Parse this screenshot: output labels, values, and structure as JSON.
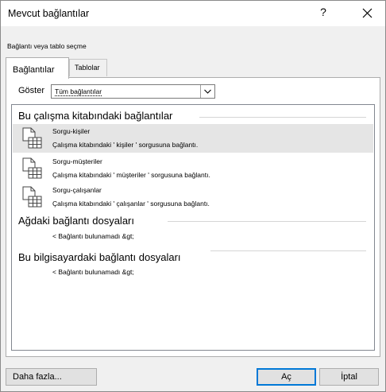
{
  "window": {
    "title": "Mevcut bağlantılar",
    "help_label": "?"
  },
  "subtitle": "Bağlantı veya tablo seçme",
  "tabs": [
    {
      "label": "Bağlantılar",
      "active": true
    },
    {
      "label": "Tablolar",
      "active": false
    }
  ],
  "show": {
    "label": "Göster",
    "selected": "Tüm bağlantılar"
  },
  "sections": [
    {
      "heading": "Bu çalışma kitabındaki bağlantılar",
      "items": [
        {
          "name": "Sorgu-kişiler",
          "description": "Çalışma kitabındaki ' kişiler ' sorgusuna bağlantı.",
          "selected": true
        },
        {
          "name": "Sorgu-müşteriler",
          "description": "Çalışma kitabındaki ' müşteriler ' sorgusuna bağlantı.",
          "selected": false
        },
        {
          "name": "Sorgu-çalışanlar",
          "description": "Çalışma kitabındaki ' çalışanlar ' sorgusuna bağlantı.",
          "selected": false
        }
      ]
    },
    {
      "heading": "Ağdaki bağlantı dosyaları",
      "empty_message": "< Bağlantı bulunamadı &gt;"
    },
    {
      "heading": "Bu bilgisayardaki bağlantı dosyaları",
      "empty_message": "< Bağlantı bulunamadı &gt;"
    }
  ],
  "buttons": {
    "more": "Daha fazla...",
    "open": "Aç",
    "cancel": "İptal"
  },
  "colors": {
    "dialog_bg": "#f0f0f0",
    "selected_row": "#e5e5e5",
    "default_button_border": "#0078d7"
  }
}
